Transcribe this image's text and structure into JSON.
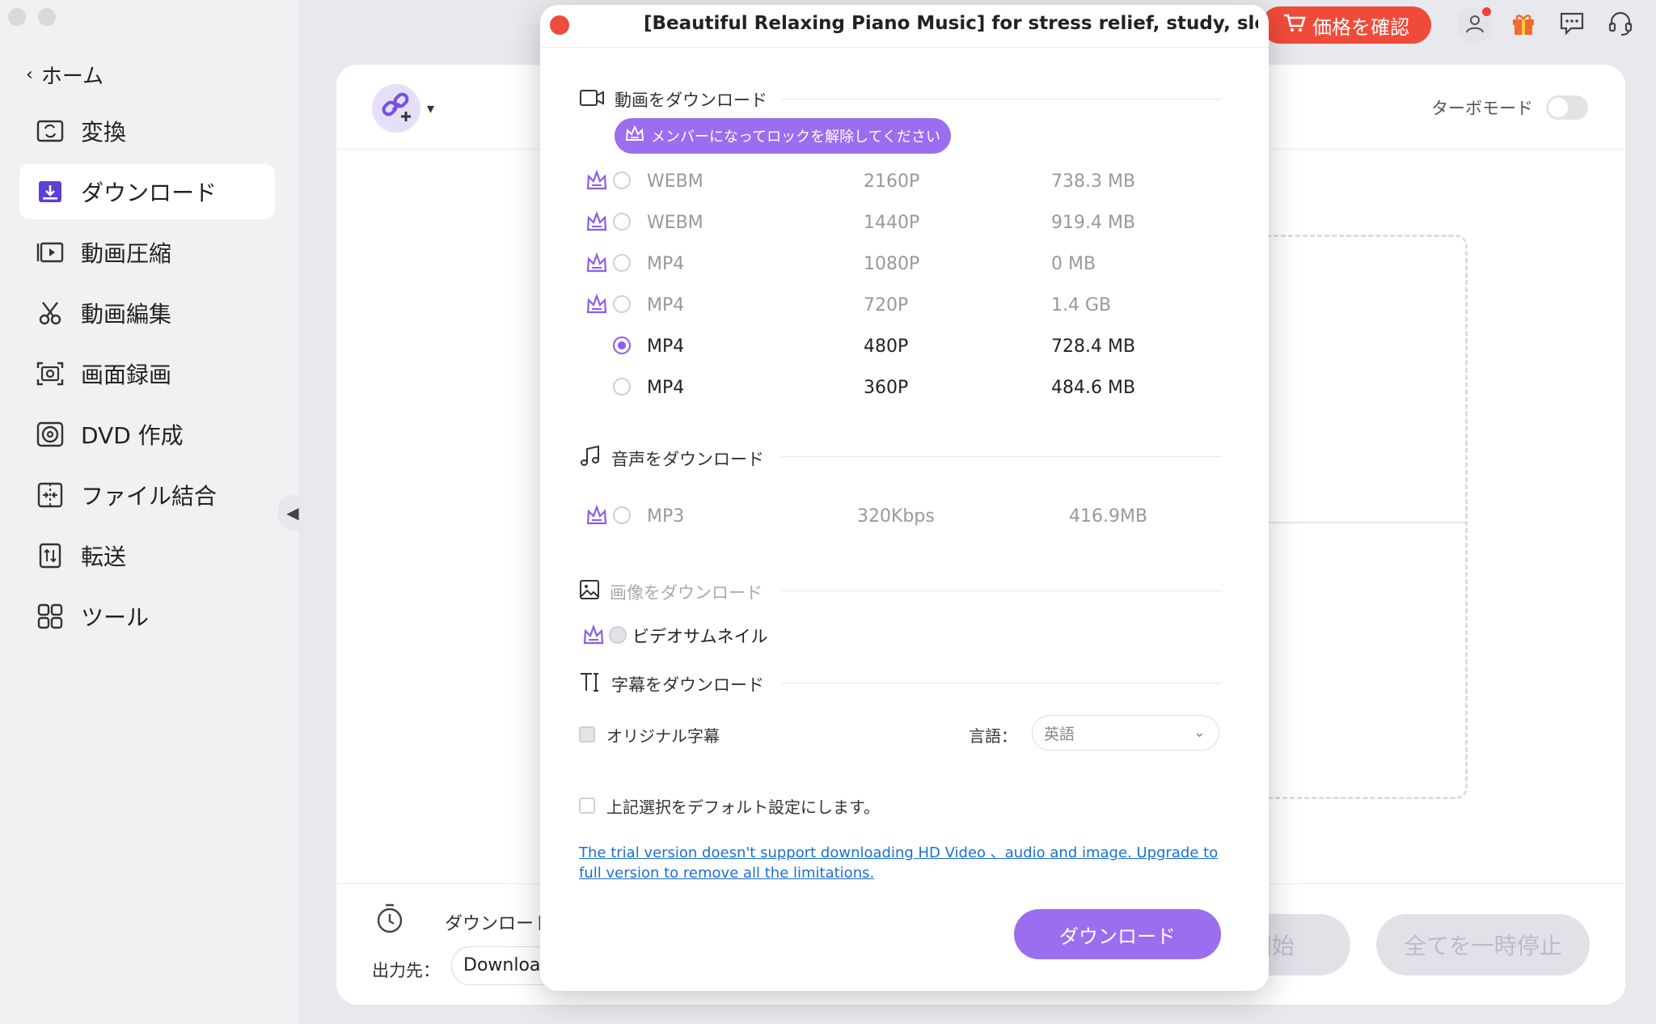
{
  "sidebar": {
    "home": "ホーム",
    "items": [
      {
        "label": "変換",
        "icon": "convert-icon"
      },
      {
        "label": "ダウンロード",
        "icon": "download-icon",
        "active": true
      },
      {
        "label": "動画圧縮",
        "icon": "compress-icon"
      },
      {
        "label": "動画編集",
        "icon": "scissors-icon"
      },
      {
        "label": "画面録画",
        "icon": "screen-record-icon"
      },
      {
        "label": "DVD 作成",
        "icon": "dvd-icon"
      },
      {
        "label": "ファイル結合",
        "icon": "merge-icon"
      },
      {
        "label": "転送",
        "icon": "transfer-icon"
      },
      {
        "label": "ツール",
        "icon": "tools-icon"
      }
    ]
  },
  "topbar": {
    "price_button": "価格を確認"
  },
  "main": {
    "turbo_label": "ターボモード",
    "download_label": "ダウンロード",
    "output_label": "出力先：",
    "output_value": "Downloa",
    "start_button": "開始",
    "pause_all_button": "全てを一時停止"
  },
  "modal": {
    "title": "[Beautiful Relaxing Piano Music] for stress relief, study, sleep...",
    "video_section": "動画をダウンロード",
    "member_unlock": "メンバーになってロックを解除してください",
    "video_options": [
      {
        "format": "WEBM",
        "resolution": "2160P",
        "size": "738.3 MB",
        "locked": true,
        "selected": false
      },
      {
        "format": "WEBM",
        "resolution": "1440P",
        "size": "919.4 MB",
        "locked": true,
        "selected": false
      },
      {
        "format": "MP4",
        "resolution": "1080P",
        "size": "0 MB",
        "locked": true,
        "selected": false
      },
      {
        "format": "MP4",
        "resolution": "720P",
        "size": "1.4 GB",
        "locked": true,
        "selected": false
      },
      {
        "format": "MP4",
        "resolution": "480P",
        "size": "728.4 MB",
        "locked": false,
        "selected": true
      },
      {
        "format": "MP4",
        "resolution": "360P",
        "size": "484.6 MB",
        "locked": false,
        "selected": false
      }
    ],
    "audio_section": "音声をダウンロード",
    "audio_options": [
      {
        "format": "MP3",
        "bitrate": "320Kbps",
        "size": "416.9MB",
        "locked": true
      }
    ],
    "image_section": "画像をダウンロード",
    "thumbnail_label": "ビデオサムネイル",
    "subtitle_section": "字幕をダウンロード",
    "original_subtitle": "オリジナル字幕",
    "language_label": "言語：",
    "language_value": "英語",
    "default_setting": "上記選択をデフォルト設定にします。",
    "trial_notice": "The trial version doesn't support downloading HD Video 、audio and image. Upgrade to full version to remove all the limitations.",
    "download_button": "ダウンロード"
  },
  "colors": {
    "accent": "#9b6ef0",
    "price_red": "#f04b3a",
    "link_blue": "#1a6fd8"
  }
}
